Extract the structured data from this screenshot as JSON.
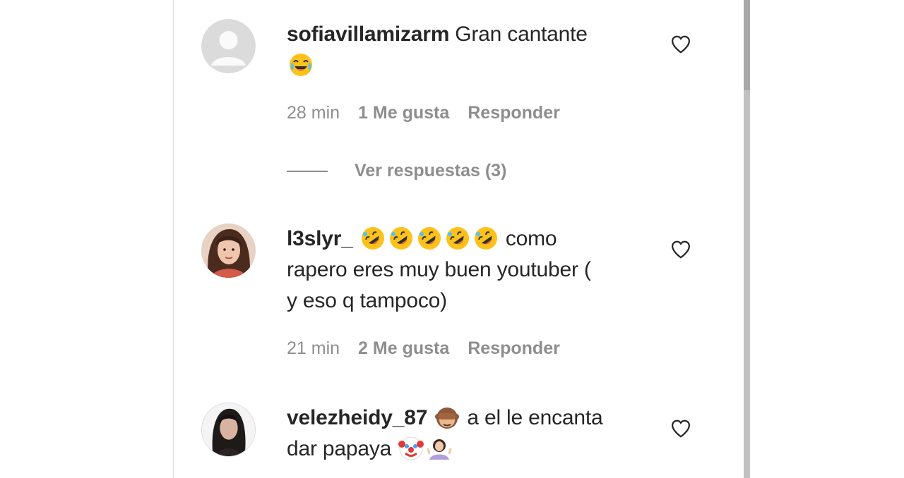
{
  "comments": [
    {
      "username": "sofiavillamizarm",
      "text": "Gran cantante",
      "emojis": [
        "face-with-tears-of-joy"
      ],
      "time": "28 min",
      "likes": "1 Me gusta",
      "reply": "Responder"
    },
    {
      "username": "l3slyr_",
      "lines": [
        "como",
        "rapero eres muy buen youtuber (",
        "y eso q tampoco)"
      ],
      "emojis": [
        "rolling-on-floor-laughing",
        "rolling-on-floor-laughing",
        "rolling-on-floor-laughing",
        "rolling-on-floor-laughing",
        "rolling-on-floor-laughing"
      ],
      "time": "21 min",
      "likes": "2 Me gusta",
      "reply": "Responder"
    },
    {
      "username": "velezheidy_87",
      "line1": "a el le encanta",
      "line2": "dar papaya",
      "emojis": [
        "see-no-evil-monkey",
        "clown-face",
        "person-shrugging"
      ]
    }
  ],
  "view_replies": "Ver respuestas (3)",
  "colors": {
    "text": "#262626",
    "muted": "#8e8e8e",
    "border": "#dbdbdb"
  }
}
